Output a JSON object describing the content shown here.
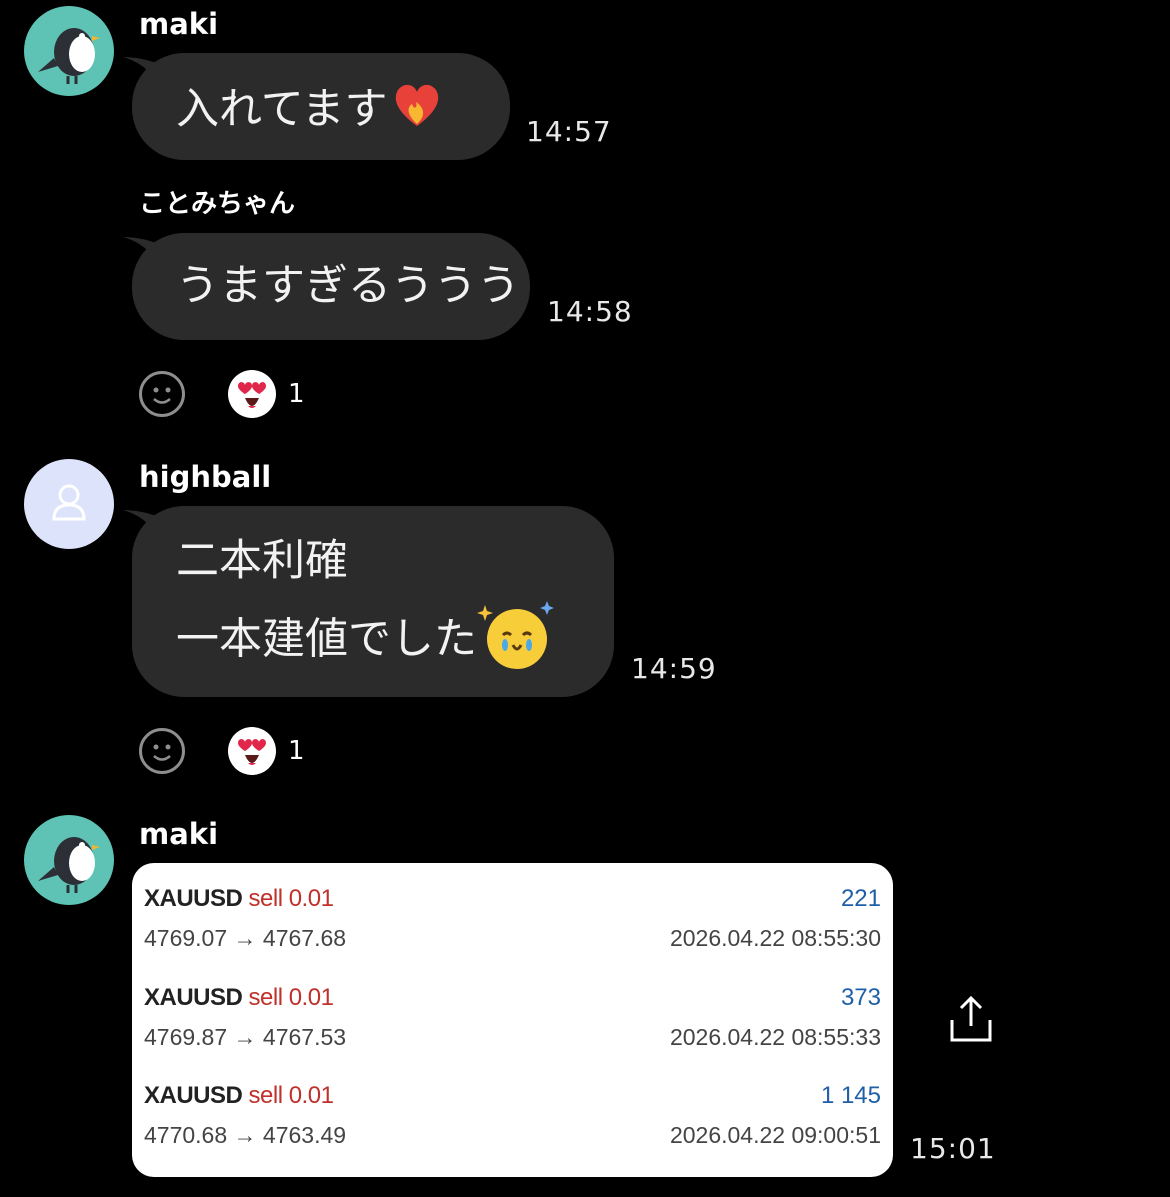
{
  "messages": [
    {
      "sender": "maki",
      "text": "入れてます",
      "emoji": "heart-on-fire",
      "time": "14:57"
    },
    {
      "sender": "ことみちゃん",
      "text": "うますぎるううう",
      "time": "14:58",
      "reaction_count": "1"
    },
    {
      "sender": "highball",
      "line1": "二本利確",
      "line2": "一本建値でした",
      "emoji": "sparkling-teary-face",
      "time": "14:59",
      "reaction_count": "1"
    },
    {
      "sender": "maki",
      "time": "15:01"
    }
  ],
  "trades": [
    {
      "symbol": "XAUUSD",
      "side": "sell",
      "lot": "0.01",
      "profit": "221",
      "prices": "4769.07 → 4767.68",
      "datetime": "2026.04.22 08:55:30"
    },
    {
      "symbol": "XAUUSD",
      "side": "sell",
      "lot": "0.01",
      "profit": "373",
      "prices": "4769.87 → 4767.53",
      "datetime": "2026.04.22 08:55:33"
    },
    {
      "symbol": "XAUUSD",
      "side": "sell",
      "lot": "0.01",
      "profit": "1 145",
      "prices": "4770.68 → 4763.49",
      "datetime": "2026.04.22 09:00:51"
    }
  ],
  "colors": {
    "background": "#000000",
    "bubble": "#2b2b2b",
    "avatar_teal": "#5ec3b4",
    "profit_blue": "#1f5fa8",
    "sell_red": "#c0312b"
  }
}
